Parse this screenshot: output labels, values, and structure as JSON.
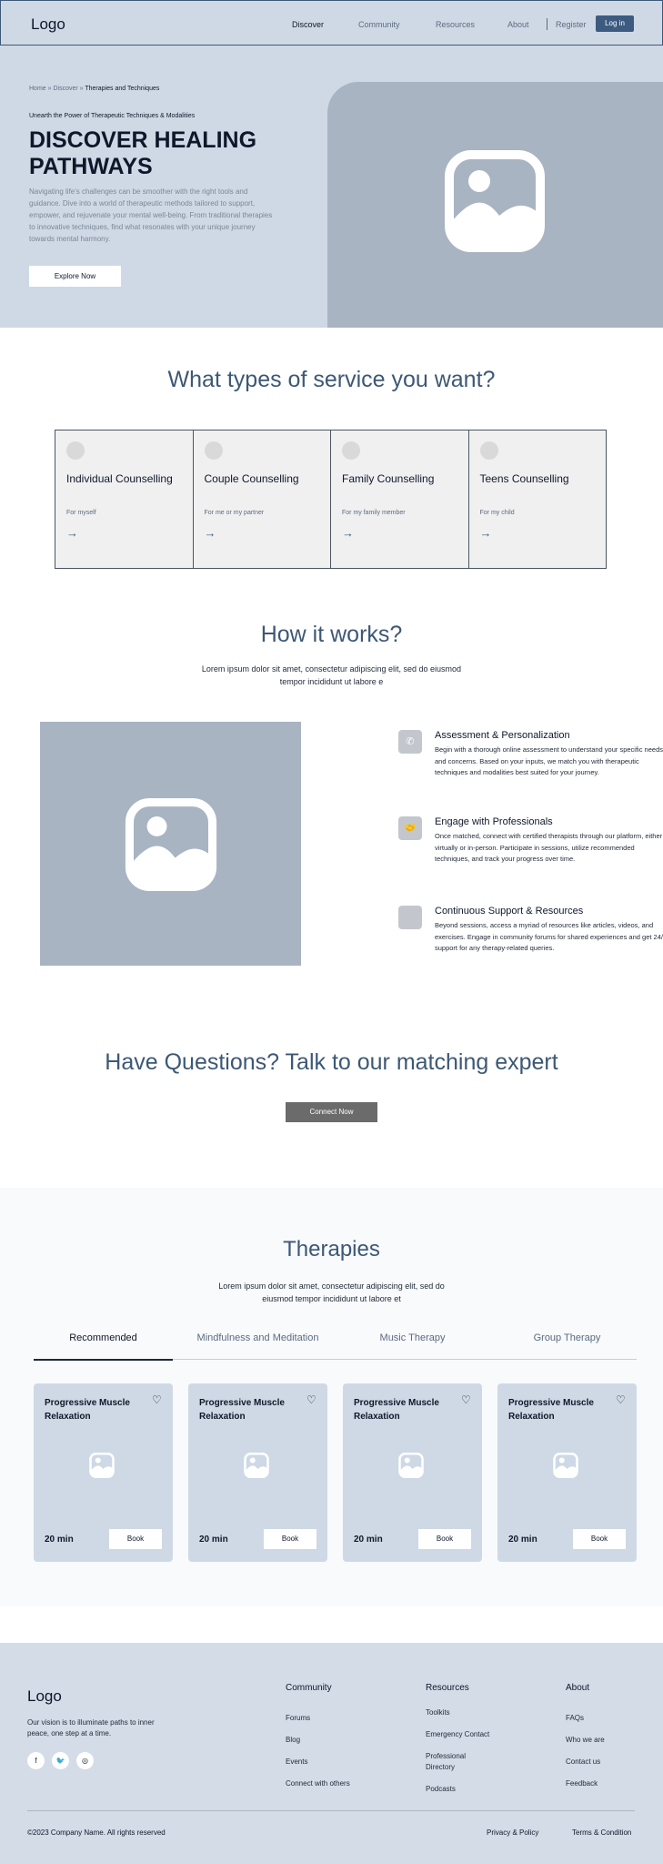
{
  "nav": {
    "logo": "Logo",
    "links": [
      "Discover",
      "Community",
      "Resources",
      "About"
    ],
    "register": "Register",
    "login": "Log in"
  },
  "hero": {
    "breadcrumb": {
      "home": "Home",
      "sep1": " » ",
      "discover": "Discover",
      "sep2": " » ",
      "current": "Therapies and Techniques"
    },
    "eyebrow": "Unearth the Power of Therapeutic Techniques & Modalities",
    "title": "DISCOVER HEALING PATHWAYS",
    "description": "Navigating life's challenges can be smoother with the right tools and guidance. Dive into a world of therapeutic methods tailored to support, empower, and rejuvenate your mental well-being. From traditional therapies to innovative techniques, find what resonates with your unique journey towards mental harmony.",
    "cta": "Explore Now"
  },
  "services": {
    "title": "What types of service you want?",
    "cards": [
      {
        "title": "Individual Counselling",
        "sub": "For myself",
        "arrow": "→"
      },
      {
        "title": "Couple Counselling",
        "sub": "For me or my partner",
        "arrow": "→"
      },
      {
        "title": "Family Counselling",
        "sub": "For my family member",
        "arrow": "→"
      },
      {
        "title": "Teens Counselling",
        "sub": "For my child",
        "arrow": "→"
      }
    ]
  },
  "how": {
    "title": "How it works?",
    "subtitle": "Lorem ipsum dolor sit amet, consectetur adipiscing elit, sed do eiusmod tempor incididunt ut labore e",
    "steps": [
      {
        "icon": "phone-icon",
        "glyph": "✆",
        "title": "Assessment & Personalization",
        "text": "Begin with a thorough online assessment to understand your specific needs and concerns. Based on your inputs, we match you with therapeutic techniques and modalities best suited for your journey."
      },
      {
        "icon": "handshake-icon",
        "glyph": "🤝",
        "title": "Engage with Professionals",
        "text": "Once matched, connect with certified therapists through our platform, either virtually or in-person. Participate in sessions, utilize recommended techniques, and track your progress over time."
      },
      {
        "icon": "support-icon",
        "glyph": "",
        "title": "Continuous Support & Resources",
        "text": "Beyond sessions, access a myriad of resources like articles, videos, and exercises. Engage in community forums for shared experiences and get 24/7 support for any therapy-related queries."
      }
    ]
  },
  "questions": {
    "title": "Have Questions? Talk to our matching expert",
    "cta": "Connect Now"
  },
  "therapies": {
    "title": "Therapies",
    "subtitle": "Lorem ipsum dolor sit amet, consectetur adipiscing elit, sed do eiusmod tempor incididunt ut labore et",
    "tabs": [
      "Recommended",
      "Mindfulness and Meditation",
      "Music Therapy",
      "Group Therapy"
    ],
    "cards": [
      {
        "name": "Progressive Muscle Relaxation",
        "duration": "20 min",
        "book": "Book",
        "heart": "♡"
      },
      {
        "name": "Progressive Muscle Relaxation",
        "duration": "20 min",
        "book": "Book",
        "heart": "♡"
      },
      {
        "name": "Progressive Muscle Relaxation",
        "duration": "20 min",
        "book": "Book",
        "heart": "♡"
      },
      {
        "name": "Progressive Muscle Relaxation",
        "duration": "20 min",
        "book": "Book",
        "heart": "♡"
      }
    ]
  },
  "footer": {
    "logo": "Logo",
    "vision": "Our vision is to illuminate paths to inner peace, one step at a time.",
    "social": [
      {
        "icon": "facebook-icon",
        "glyph": "f"
      },
      {
        "icon": "twitter-icon",
        "glyph": "🐦"
      },
      {
        "icon": "instagram-icon",
        "glyph": "◎"
      }
    ],
    "columns": [
      {
        "title": "Community",
        "items": [
          "Forums",
          "Blog",
          "Events",
          "Connect with others"
        ]
      },
      {
        "title": "Resources",
        "items": [
          "Toolkits",
          "Emergency Contact",
          "Professional Directory",
          "Podcasts"
        ]
      },
      {
        "title": "About",
        "items": [
          "FAQs",
          "Who we are",
          "Contact us",
          "Feedback"
        ]
      }
    ],
    "copyright": "©2023 Company Name. All rights reserved",
    "privacy": "Privacy & Policy",
    "terms": "Terms & Condition"
  }
}
